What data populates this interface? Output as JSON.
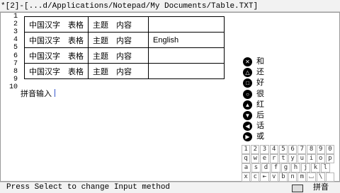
{
  "window": {
    "title": "*[2]-[...d/Applications/Notepad/My Documents/Table.TXT]"
  },
  "editor": {
    "line_numbers": [
      "1",
      "2",
      "3",
      "4",
      "5",
      "6",
      "7",
      "8",
      "9",
      "10"
    ],
    "table": {
      "rows": [
        [
          "中国汉字　表格",
          "主题　内容",
          ""
        ],
        [
          "中国汉字　表格",
          "主题　内容",
          "English"
        ],
        [
          "中国汉字　表格",
          "主题　内容",
          ""
        ],
        [
          "中国汉字　表格",
          "主题　内容",
          ""
        ]
      ]
    },
    "input_line": "拼音输入"
  },
  "candidates": [
    {
      "button": "✕",
      "icon": "cross-button-icon",
      "char": "和"
    },
    {
      "button": "△",
      "icon": "triangle-button-icon",
      "char": "还"
    },
    {
      "button": "□",
      "icon": "square-button-icon",
      "char": "好"
    },
    {
      "button": "○",
      "icon": "circle-button-icon",
      "char": "很"
    },
    {
      "button": "▲",
      "icon": "dpad-up-icon",
      "char": "红"
    },
    {
      "button": "▼",
      "icon": "dpad-down-icon",
      "char": "后"
    },
    {
      "button": "◀",
      "icon": "dpad-left-icon",
      "char": "话"
    },
    {
      "button": "▶",
      "icon": "dpad-right-icon",
      "char": "或"
    }
  ],
  "keyboard": [
    [
      "1",
      "2",
      "3",
      "4",
      "5",
      "6",
      "7",
      "8",
      "9",
      "0"
    ],
    [
      "q",
      "w",
      "e",
      "r",
      "t",
      "y",
      "u",
      "i",
      "o",
      "p"
    ],
    [
      "a",
      "s",
      "d",
      "f",
      "g",
      "h",
      "j",
      "k",
      "l"
    ],
    [
      "x",
      "c",
      "⇤",
      "v",
      "b",
      "n",
      "m",
      "⌴",
      "\\",
      ""
    ],
    [
      "-",
      "'",
      "=",
      "(",
      ")",
      "\\",
      "/",
      ",",
      "[",
      "]"
    ]
  ],
  "status": {
    "message": "Press Select to change Input method",
    "input_method": "拼音"
  }
}
